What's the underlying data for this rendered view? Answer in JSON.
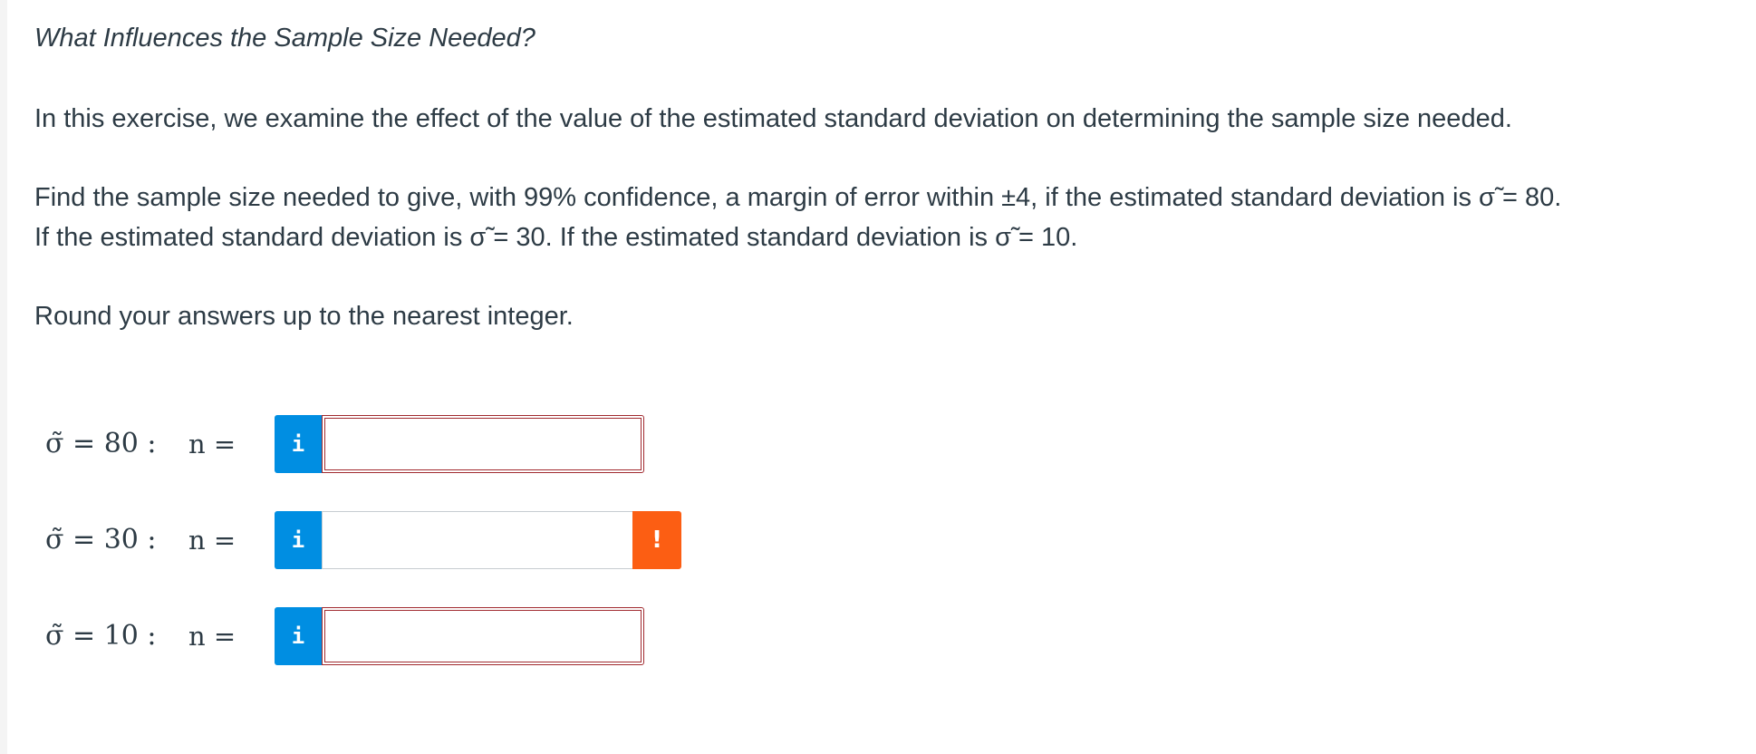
{
  "question": {
    "title": "What Influences the Sample Size Needed?",
    "intro": "In this exercise, we examine the effect of the value of the estimated standard deviation on determining the sample size needed.",
    "line1": "Find the sample size needed to give, with 99% confidence, a margin of error within ±4, if the estimated standard deviation is σ̃ = 80.",
    "line2": "If the estimated standard deviation is σ̃ = 30. If the estimated standard deviation is σ̃ = 10.",
    "rounding": "Round your answers up to the nearest integer."
  },
  "answers": [
    {
      "sigma_label": "σ̃ = 80 :",
      "n_label": "n =",
      "info_label": "i",
      "value": "",
      "state": "invalid"
    },
    {
      "sigma_label": "σ̃ = 30 :",
      "n_label": "n =",
      "info_label": "i",
      "value": "",
      "state": "warning",
      "warning_label": "!"
    },
    {
      "sigma_label": "σ̃ = 10 :",
      "n_label": "n =",
      "info_label": "i",
      "value": "",
      "state": "invalid"
    }
  ],
  "colors": {
    "info": "#008ee2",
    "warning": "#fc5e13",
    "invalid_border": "#a12a2f",
    "text": "#2d3b45"
  },
  "icons": {
    "info": "info-icon",
    "warning": "exclamation-icon"
  }
}
